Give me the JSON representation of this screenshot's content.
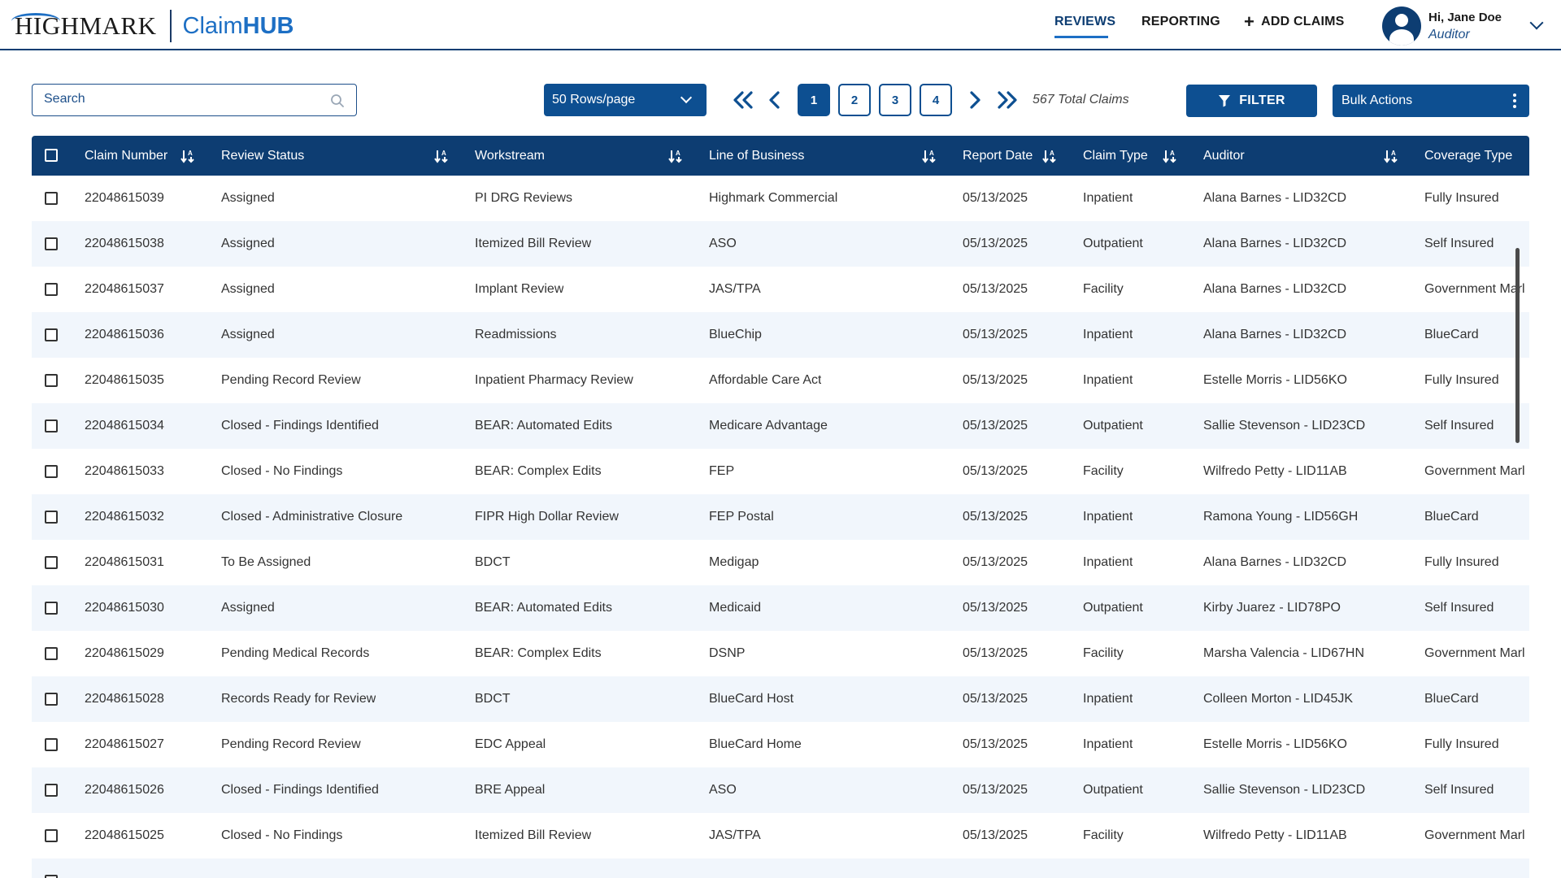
{
  "brand": {
    "company": "HIGHMARK",
    "app_prefix": "Claim",
    "app_suffix": "HUB"
  },
  "nav": {
    "reviews": "REVIEWS",
    "reporting": "REPORTING",
    "add_claims": "ADD CLAIMS"
  },
  "user": {
    "greeting": "Hi, Jane Doe",
    "role": "Auditor"
  },
  "toolbar": {
    "search_placeholder": "Search",
    "rows_per_page": "50 Rows/page",
    "pages": [
      "1",
      "2",
      "3",
      "4"
    ],
    "total_claims": "567 Total Claims",
    "filter_label": "FILTER",
    "bulk_label": "Bulk Actions"
  },
  "table": {
    "columns": [
      "Claim Number",
      "Review Status",
      "Workstream",
      "Line of Business",
      "Report Date",
      "Claim Type",
      "Auditor",
      "Coverage Type"
    ],
    "rows": [
      [
        "22048615039",
        "Assigned",
        "PI DRG Reviews",
        "Highmark Commercial",
        "05/13/2025",
        "Inpatient",
        "Alana Barnes - LID32CD",
        "Fully Insured"
      ],
      [
        "22048615038",
        "Assigned",
        "Itemized Bill Review",
        "ASO",
        "05/13/2025",
        "Outpatient",
        "Alana Barnes - LID32CD",
        "Self Insured"
      ],
      [
        "22048615037",
        "Assigned",
        "Implant Review",
        "JAS/TPA",
        "05/13/2025",
        "Facility",
        "Alana Barnes - LID32CD",
        "Government Marl"
      ],
      [
        "22048615036",
        "Assigned",
        "Readmissions",
        "BlueChip",
        "05/13/2025",
        "Inpatient",
        "Alana Barnes - LID32CD",
        "BlueCard"
      ],
      [
        "22048615035",
        "Pending Record Review",
        "Inpatient Pharmacy Review",
        "Affordable Care Act",
        "05/13/2025",
        "Inpatient",
        "Estelle Morris - LID56KO",
        "Fully Insured"
      ],
      [
        "22048615034",
        "Closed - Findings Identified",
        "BEAR: Automated Edits",
        "Medicare Advantage",
        "05/13/2025",
        "Outpatient",
        "Sallie Stevenson - LID23CD",
        "Self Insured"
      ],
      [
        "22048615033",
        "Closed - No Findings",
        "BEAR: Complex Edits",
        "FEP",
        "05/13/2025",
        "Facility",
        "Wilfredo Petty - LID11AB",
        "Government Marl"
      ],
      [
        "22048615032",
        "Closed - Administrative Closure",
        "FIPR High Dollar Review",
        "FEP Postal",
        "05/13/2025",
        "Inpatient",
        "Ramona Young - LID56GH",
        "BlueCard"
      ],
      [
        "22048615031",
        "To Be Assigned",
        "BDCT",
        "Medigap",
        "05/13/2025",
        "Inpatient",
        "Alana Barnes - LID32CD",
        "Fully Insured"
      ],
      [
        "22048615030",
        "Assigned",
        "BEAR: Automated Edits",
        "Medicaid",
        "05/13/2025",
        "Outpatient",
        "Kirby Juarez - LID78PO",
        "Self Insured"
      ],
      [
        "22048615029",
        "Pending Medical Records",
        "BEAR: Complex Edits",
        "DSNP",
        "05/13/2025",
        "Facility",
        "Marsha Valencia - LID67HN",
        "Government Marl"
      ],
      [
        "22048615028",
        "Records Ready for Review",
        "BDCT",
        "BlueCard Host",
        "05/13/2025",
        "Inpatient",
        "Colleen Morton - LID45JK",
        "BlueCard"
      ],
      [
        "22048615027",
        "Pending Record Review",
        "EDC Appeal",
        "BlueCard Home",
        "05/13/2025",
        "Inpatient",
        "Estelle Morris - LID56KO",
        "Fully Insured"
      ],
      [
        "22048615026",
        "Closed - Findings Identified",
        "BRE Appeal",
        "ASO",
        "05/13/2025",
        "Outpatient",
        "Sallie Stevenson - LID23CD",
        "Self Insured"
      ],
      [
        "22048615025",
        "Closed - No Findings",
        "Itemized Bill Review",
        "JAS/TPA",
        "05/13/2025",
        "Facility",
        "Wilfredo Petty - LID11AB",
        "Government Marl"
      ]
    ]
  }
}
